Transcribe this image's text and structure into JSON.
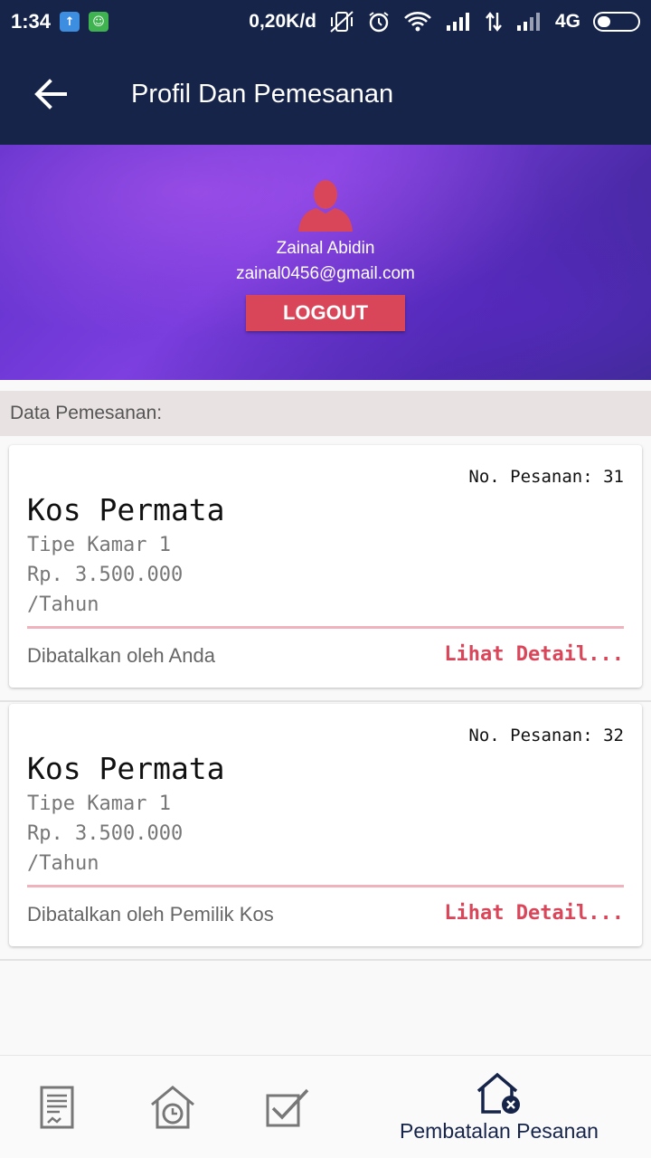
{
  "status_bar": {
    "time": "1:34",
    "net_speed": "0,20K/d",
    "network": "4G"
  },
  "appbar": {
    "title": "Profil Dan Pemesanan",
    "back_icon": "arrow-back-icon"
  },
  "profile": {
    "name": "Zainal Abidin",
    "email": "zainal0456@gmail.com",
    "logout_label": "LOGOUT"
  },
  "orders_section": {
    "label": "Data Pemesanan:"
  },
  "orders": [
    {
      "order_no": "No. Pesanan: 31",
      "kos_name": "Kos Permata",
      "room_type": "Tipe Kamar 1",
      "price": "Rp. 3.500.000",
      "period": "/Tahun",
      "status": "Dibatalkan oleh Anda",
      "detail_label": "Lihat Detail..."
    },
    {
      "order_no": "No. Pesanan: 32",
      "kos_name": "Kos Permata",
      "room_type": "Tipe Kamar 1",
      "price": "Rp. 3.500.000",
      "period": "/Tahun",
      "status": "Dibatalkan oleh Pemilik Kos",
      "detail_label": "Lihat Detail..."
    }
  ],
  "bottom_nav": {
    "active_label": "Pembatalan Pesanan",
    "items": [
      "document-icon",
      "house-clock-icon",
      "checkbox-icon",
      "house-cancel-icon"
    ]
  },
  "colors": {
    "primary": "#16244a",
    "accent": "#d9465a",
    "divider": "#f0b3bb"
  }
}
